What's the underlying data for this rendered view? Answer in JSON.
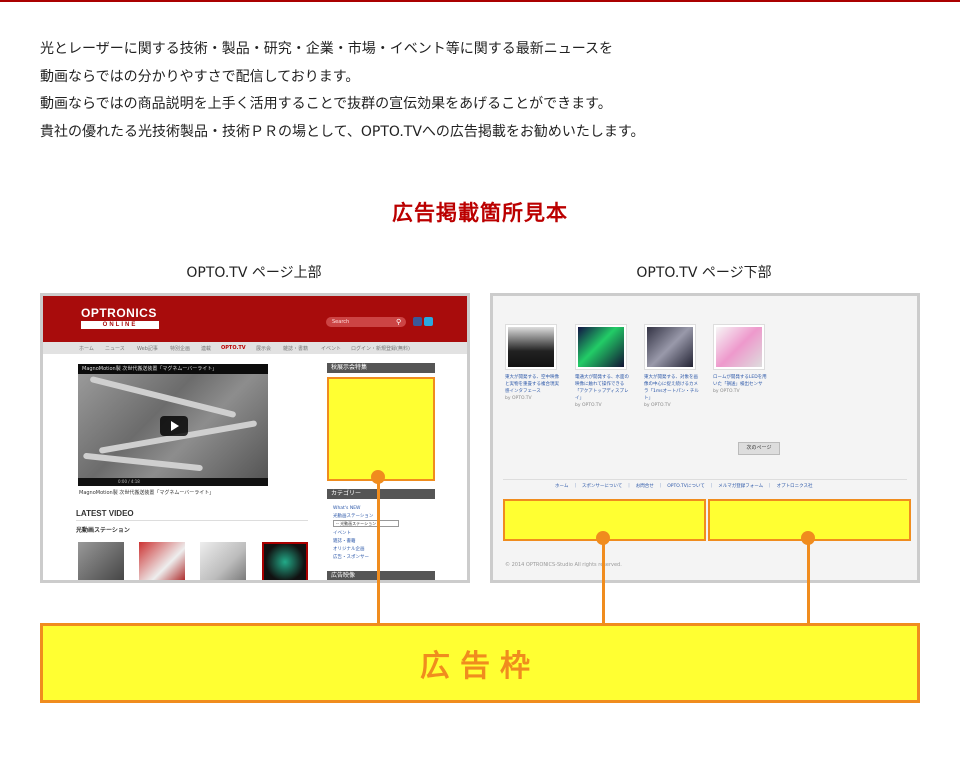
{
  "intro_lines": [
    "光とレーザーに関する技術・製品・研究・企業・市場・イベント等に関する最新ニュースを",
    "動画ならではの分かりやすさで配信しております。",
    "動画ならではの商品説明を上手く活用することで抜群の宣伝効果をあげることができます。",
    "貴社の優れたる光技術製品・技術ＰＲの場として、OPTO.TVへの広告掲載をお勧めいたします。"
  ],
  "section_title": "広告掲載箇所見本",
  "captions": {
    "top": "OPTO.TV ページ上部",
    "bottom": "OPTO.TV ページ下部"
  },
  "left_site": {
    "logo": "OPTRONICS",
    "logo_sub": "ONLINE",
    "search_placeholder": "Search",
    "nav": [
      "ホーム",
      "ニュース",
      "Web記事",
      "特別企画",
      "連載",
      "OPTO.TV",
      "展示会",
      "雑誌・書籍",
      "イベント",
      "ログイン・新規登録(無料)"
    ],
    "video_title": "MagnoMotion製 次世代搬送装置「マグネムーバーライト」",
    "video_time": "0:00 / 4:18",
    "video_caption": "MagnoMotion製 次世代搬送装置「マグネムーバーライト」",
    "latest_video": "LATEST VIDEO",
    "latest_sub": "光動画ステーション",
    "side_exhibition": "秋展示会特集",
    "side_category": "カテゴリー",
    "categories": [
      "What's NEW",
      "光動画ステーション"
    ],
    "categories_after": [
      "イベント",
      "雑誌・書籍",
      "オリジナル企画",
      "広告・スポンサー"
    ],
    "select_value": "-- 光動画ステーション ▾",
    "side_ad": "広告映像"
  },
  "right_site": {
    "items": [
      {
        "text": "東大が開発する、空中映像と実物を重畳する複合現実感インタフェース",
        "by": "by OPTO.TV"
      },
      {
        "text": "電通大が開発する、水面の映像に触れて操作できる「アクアトップディスプレイ」",
        "by": "by OPTO.TV"
      },
      {
        "text": "東大が開発する、対象を画像の中心に捉え続けるカメラ「1msオートパン・チルト」",
        "by": "by OPTO.TV"
      },
      {
        "text": "ロームが開発するLEDを用いた「損送」検出センサ",
        "by": "by OPTO.TV"
      }
    ],
    "next_page": "次のページ",
    "footer_nav": "ホーム　｜　スポンサーについて　｜　お問合せ　｜　OPTO.TVについて　｜　メルマガ登録フォーム　｜　オプトロニクス社",
    "copyright": "© 2014 OPTRONICS-Studio All rights reserved."
  },
  "ad_label": "広告枠",
  "colors": {
    "accent_red": "#b00000",
    "ad_yellow": "#ffff32",
    "ad_orange": "#f08c1e"
  }
}
